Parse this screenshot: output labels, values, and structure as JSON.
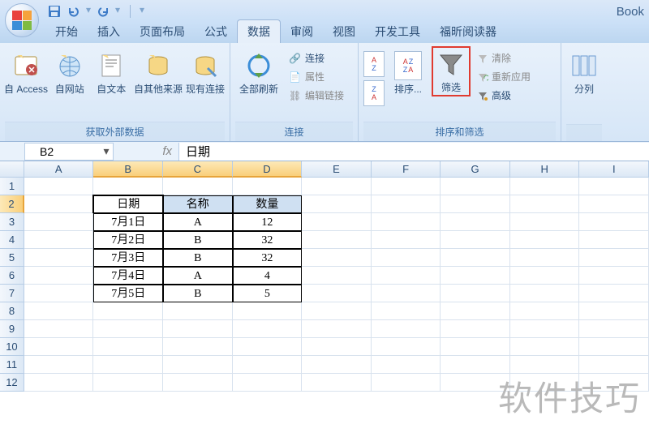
{
  "app_title": "Book",
  "quick_access": [
    "save",
    "undo",
    "redo"
  ],
  "tabs": [
    {
      "id": "home",
      "label": "开始"
    },
    {
      "id": "insert",
      "label": "插入"
    },
    {
      "id": "layout",
      "label": "页面布局"
    },
    {
      "id": "formula",
      "label": "公式"
    },
    {
      "id": "data",
      "label": "数据",
      "active": true
    },
    {
      "id": "review",
      "label": "审阅"
    },
    {
      "id": "view",
      "label": "视图"
    },
    {
      "id": "dev",
      "label": "开发工具"
    },
    {
      "id": "foxit",
      "label": "福昕阅读器"
    }
  ],
  "ribbon": {
    "group_external": {
      "label": "获取外部数据",
      "items": [
        {
          "id": "from-access",
          "label": "自 Access"
        },
        {
          "id": "from-web",
          "label": "自网站"
        },
        {
          "id": "from-text",
          "label": "自文本"
        },
        {
          "id": "from-other",
          "label": "自其他来源"
        },
        {
          "id": "existing-conn",
          "label": "现有连接"
        }
      ]
    },
    "group_conn": {
      "label": "连接",
      "refresh": "全部刷新",
      "items": [
        {
          "id": "connections",
          "label": "连接",
          "enabled": true
        },
        {
          "id": "properties",
          "label": "属性",
          "enabled": false
        },
        {
          "id": "edit-links",
          "label": "编辑链接",
          "enabled": false
        }
      ]
    },
    "group_sort": {
      "label": "排序和筛选",
      "sort_btn": "排序...",
      "filter_btn": "筛选",
      "items": [
        {
          "id": "clear",
          "label": "清除",
          "enabled": false
        },
        {
          "id": "reapply",
          "label": "重新应用",
          "enabled": false
        },
        {
          "id": "advanced",
          "label": "高级",
          "enabled": true
        }
      ]
    },
    "group_split": {
      "label": "分列",
      "btn": "分列"
    }
  },
  "formula_bar": {
    "name": "B2",
    "content": "日期"
  },
  "columns": [
    "A",
    "B",
    "C",
    "D",
    "E",
    "F",
    "G",
    "H",
    "I"
  ],
  "rows": [
    1,
    2,
    3,
    4,
    5,
    6,
    7,
    8,
    9,
    10,
    11,
    12
  ],
  "selected_cols": [
    "B",
    "C",
    "D"
  ],
  "selected_row": 2,
  "active_cell": "B2",
  "table": {
    "header": [
      "日期",
      "名称",
      "数量"
    ],
    "data": [
      [
        "7月1日",
        "A",
        "12"
      ],
      [
        "7月2日",
        "B",
        "32"
      ],
      [
        "7月3日",
        "B",
        "32"
      ],
      [
        "7月4日",
        "A",
        "4"
      ],
      [
        "7月5日",
        "B",
        "5"
      ]
    ]
  },
  "watermark": "软件技巧"
}
